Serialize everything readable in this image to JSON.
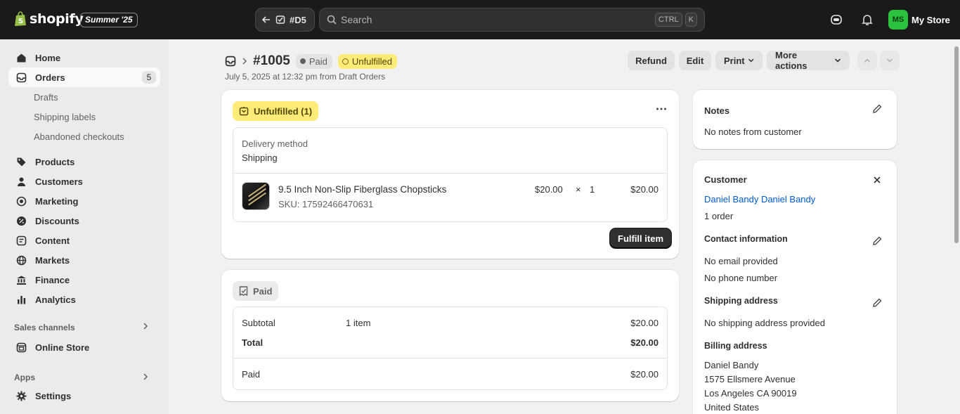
{
  "topbar": {
    "brand": "shopify",
    "edition": "Summer '25",
    "back_label": "#D5",
    "search_placeholder": "Search",
    "shortcut_ctrl": "CTRL",
    "shortcut_key": "K",
    "store_initials": "MS",
    "store_name": "My Store"
  },
  "sidebar": {
    "home": "Home",
    "orders": "Orders",
    "orders_count": "5",
    "drafts": "Drafts",
    "shipping_labels": "Shipping labels",
    "abandoned": "Abandoned checkouts",
    "products": "Products",
    "customers": "Customers",
    "marketing": "Marketing",
    "discounts": "Discounts",
    "content": "Content",
    "markets": "Markets",
    "finance": "Finance",
    "analytics": "Analytics",
    "sales_channels": "Sales channels",
    "online_store": "Online Store",
    "apps": "Apps",
    "settings": "Settings"
  },
  "header": {
    "order_number": "#1005",
    "payment_status": "Paid",
    "fulfillment_status": "Unfulfilled",
    "date_line": "July 5, 2025 at 12:32 pm from Draft Orders",
    "refund": "Refund",
    "edit": "Edit",
    "print": "Print",
    "more_actions": "More actions"
  },
  "fulfillment": {
    "status": "Unfulfilled (1)",
    "delivery_label": "Delivery method",
    "delivery_value": "Shipping",
    "item": {
      "name": "9.5 Inch Non-Slip Fiberglass Chopsticks",
      "sku": "SKU: 17592466470631",
      "price": "$20.00",
      "times": "×",
      "qty": "1",
      "total": "$20.00"
    },
    "fulfill_button": "Fulfill item"
  },
  "payment": {
    "status": "Paid",
    "subtotal_label": "Subtotal",
    "subtotal_items": "1 item",
    "subtotal_value": "$20.00",
    "total_label": "Total",
    "total_value": "$20.00",
    "paid_label": "Paid",
    "paid_value": "$20.00"
  },
  "notes": {
    "title": "Notes",
    "text": "No notes from customer"
  },
  "customer": {
    "title": "Customer",
    "name": "Daniel Bandy Daniel Bandy",
    "orders": "1 order",
    "contact_title": "Contact information",
    "email": "No email provided",
    "phone": "No phone number",
    "shipping_title": "Shipping address",
    "shipping_text": "No shipping address provided",
    "billing_title": "Billing address",
    "billing_lines": [
      "Daniel Bandy",
      "1575 Ellsmere Avenue",
      "Los Angeles CA 90019",
      "United States"
    ]
  },
  "colors": {
    "topbar_bg": "#1a1a1a",
    "unfulfilled_bg": "#ffeb78",
    "link": "#005bd3",
    "avatar_bg": "#2bc23d"
  }
}
